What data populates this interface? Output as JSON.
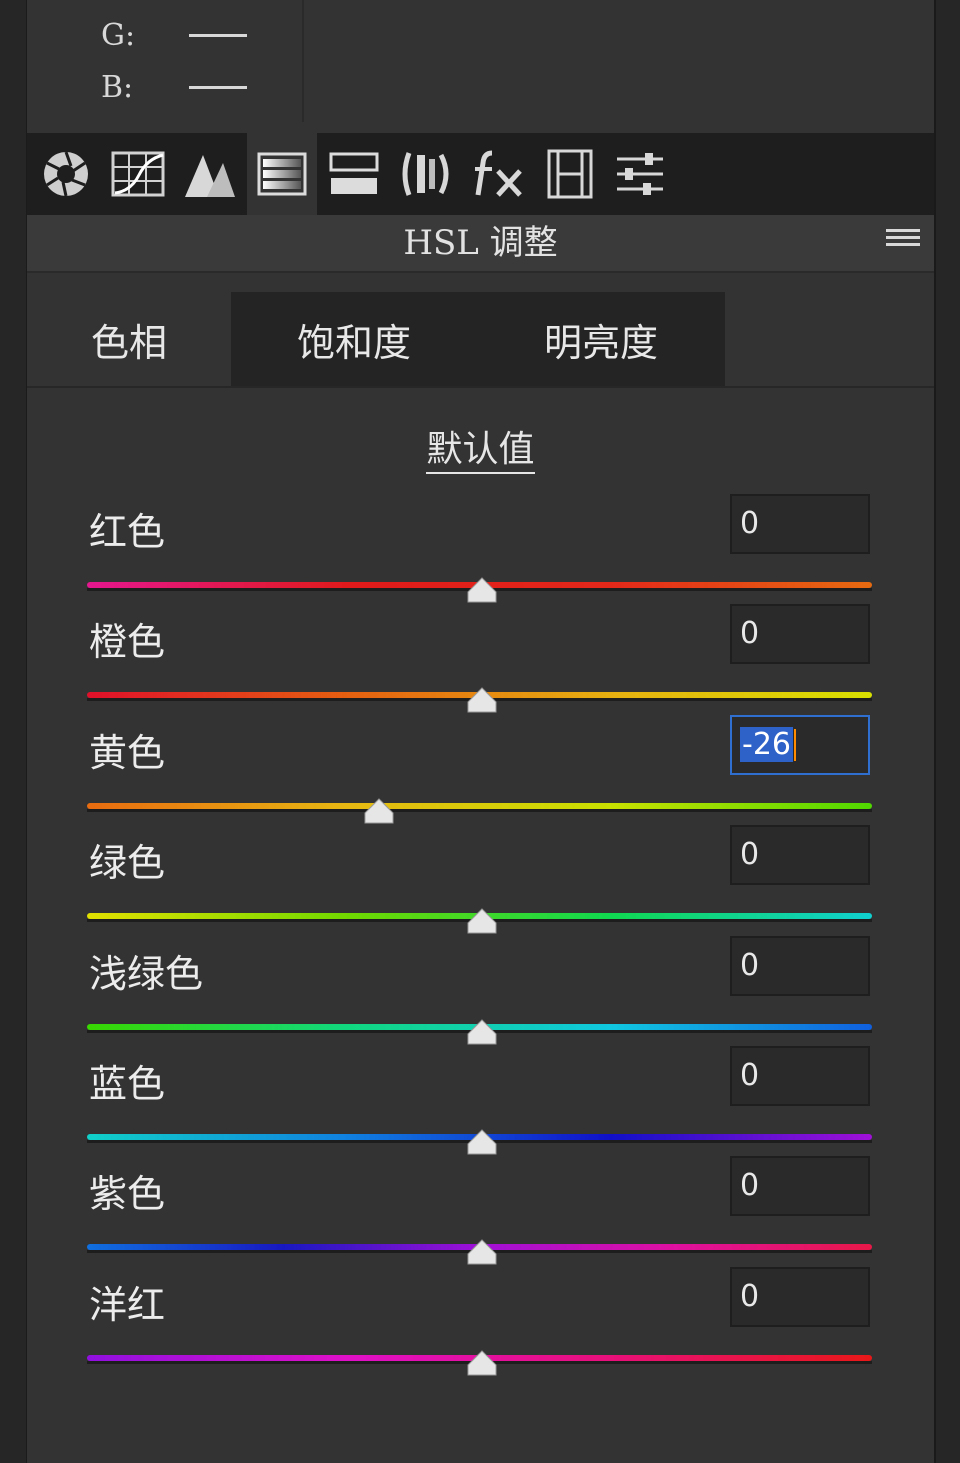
{
  "rgb": {
    "g_label": "G:",
    "b_label": "B:"
  },
  "toolbar": {
    "tools": [
      "aperture-icon",
      "grid-curve-icon",
      "mountain-detail-icon",
      "hsl-gradient-icon",
      "split-tone-icon",
      "lens-icon",
      "fx-icon",
      "film-icon",
      "sliders-icon"
    ],
    "active_index": 3
  },
  "header": {
    "title": "HSL 调整"
  },
  "tabs": [
    {
      "label": "色相",
      "active": true
    },
    {
      "label": "饱和度",
      "active": false
    },
    {
      "label": "明亮度",
      "active": false
    }
  ],
  "default_link": "默认值",
  "sliders": [
    {
      "label": "红色",
      "value": "0",
      "position": 0.5,
      "gradient": [
        "#e5178f",
        "#e01a1a",
        "#e3281a",
        "#e66a10"
      ]
    },
    {
      "label": "橙色",
      "value": "0",
      "position": 0.5,
      "gradient": [
        "#e0102a",
        "#e56010",
        "#e7b010",
        "#d8e000"
      ]
    },
    {
      "label": "黄色",
      "value": "-26",
      "position": 0.37,
      "focused": true,
      "gradient": [
        "#e86b10",
        "#e7b812",
        "#c9e000",
        "#4fd800"
      ]
    },
    {
      "label": "绿色",
      "value": "0",
      "position": 0.5,
      "gradient": [
        "#e2e000",
        "#70d800",
        "#10d850",
        "#10d0d0"
      ]
    },
    {
      "label": "浅绿色",
      "value": "0",
      "position": 0.5,
      "gradient": [
        "#38d800",
        "#10d880",
        "#10c8e0",
        "#1060e0"
      ]
    },
    {
      "label": "蓝色",
      "value": "0",
      "position": 0.5,
      "gradient": [
        "#10d0c8",
        "#1080e0",
        "#1010c8",
        "#a010d8"
      ]
    },
    {
      "label": "紫色",
      "value": "0",
      "position": 0.5,
      "gradient": [
        "#1070e0",
        "#1818c0",
        "#a010d8",
        "#e010a0",
        "#e81848"
      ]
    },
    {
      "label": "洋红",
      "value": "0",
      "position": 0.5,
      "gradient": [
        "#9010e0",
        "#e010c8",
        "#e8107a",
        "#e81818"
      ]
    }
  ]
}
